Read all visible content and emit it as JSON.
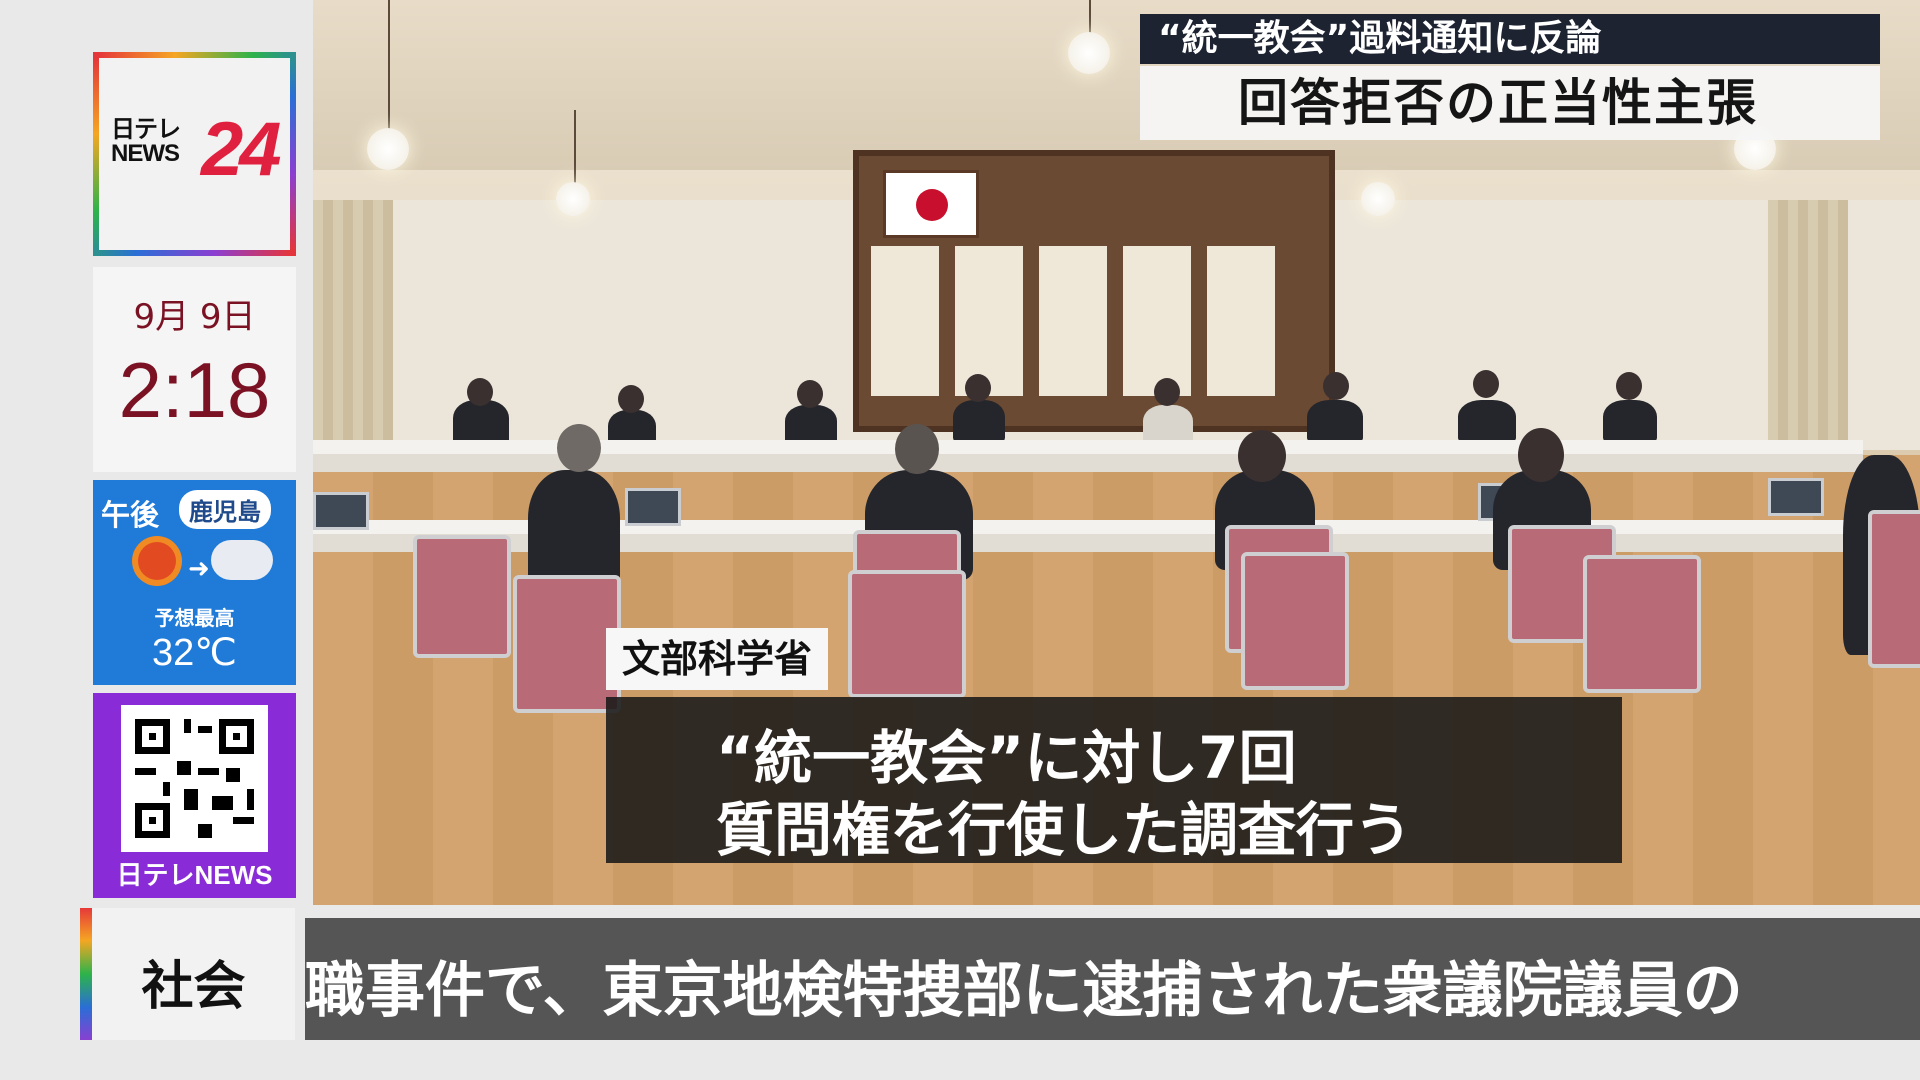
{
  "logo": {
    "top_text": "日テレ",
    "bottom_text": "NEWS",
    "number": "24"
  },
  "clock": {
    "date": "9月 9日",
    "time": "2:18"
  },
  "weather": {
    "period": "午後",
    "location": "鹿児島",
    "label": "予想最高",
    "temperature": "32℃",
    "icon": "sunny-then-cloudy-icon"
  },
  "qr": {
    "label": "日テレNEWS"
  },
  "headline": {
    "sub": "“統一教会”過料通知に反論",
    "main": "回答拒否の正当性主張"
  },
  "caption": {
    "speaker": "文部科学省",
    "line1": "“統一教会”に対し7回",
    "line2": "質問権を行使した調査行う"
  },
  "ticker": {
    "category": "社会",
    "text": "職事件で、東京地検特捜部に逮捕された衆議院議員の"
  },
  "colors": {
    "brand_red": "#e0203f",
    "weather_blue": "#1f7ad8",
    "qr_purple": "#8a2bd8",
    "headline_navy": "#1d2331"
  }
}
